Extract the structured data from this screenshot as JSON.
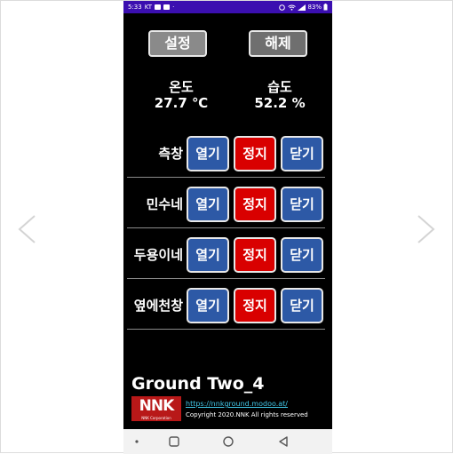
{
  "statusbar": {
    "time": "5:33",
    "carrier": "KT",
    "extra": "·",
    "battery": "83%"
  },
  "header": {
    "settings_label": "설정",
    "release_label": "해제"
  },
  "readings": {
    "temperature": {
      "label": "온도",
      "value": "27.7 ℃"
    },
    "humidity": {
      "label": "습도",
      "value": "52.2 %"
    }
  },
  "controls": [
    {
      "name": "측창",
      "open": "열기",
      "stop": "정지",
      "close": "닫기"
    },
    {
      "name": "민수네",
      "open": "열기",
      "stop": "정지",
      "close": "닫기"
    },
    {
      "name": "두용이네",
      "open": "열기",
      "stop": "정지",
      "close": "닫기"
    },
    {
      "name": "옆에천창",
      "open": "열기",
      "stop": "정지",
      "close": "닫기"
    }
  ],
  "footer": {
    "title": "Ground Two_4",
    "logo_text": "NNK",
    "logo_sub": "NNK Corporation",
    "link": "https://nnkground.modoo.at/",
    "copyright": "Copyright 2020.NNK All rights reserved"
  },
  "colors": {
    "statusbar": "#3b0fb0",
    "open_button": "#2d59a6",
    "stop_button": "#d90000",
    "grey_button": "#8a8a8a",
    "link": "#42c7e8",
    "logo": "#b81818"
  },
  "icons": {
    "prev": "chevron-left-icon",
    "next": "chevron-right-icon"
  }
}
